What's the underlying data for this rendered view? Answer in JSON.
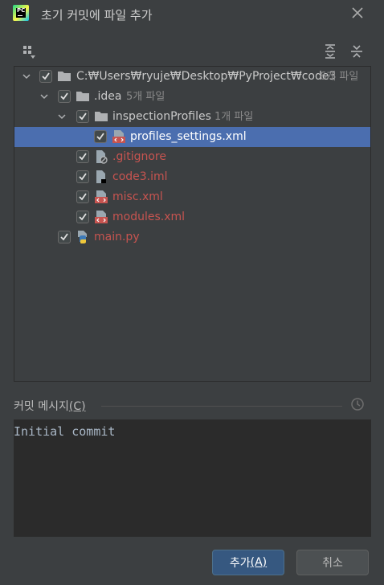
{
  "window": {
    "title": "초기 커밋에 파일 추가",
    "logo_text": "PC"
  },
  "tree": {
    "rows": [
      {
        "label": "C:₩Users₩ryuje₩Desktop₩PyProject₩code3",
        "count": "6개 파일",
        "icon": "folder-icon",
        "expanded": true,
        "checked": true
      },
      {
        "label": ".idea",
        "count": "5개 파일",
        "icon": "folder-icon",
        "expanded": true,
        "checked": true
      },
      {
        "label": "inspectionProfiles",
        "count": "1개 파일",
        "icon": "folder-icon",
        "expanded": true,
        "checked": true
      },
      {
        "label": "profiles_settings.xml",
        "icon": "xml-file-icon",
        "checked": true,
        "selected": true
      },
      {
        "label": ".gitignore",
        "icon": "ignore-file-icon",
        "checked": true
      },
      {
        "label": "code3.iml",
        "icon": "iml-file-icon",
        "checked": true
      },
      {
        "label": "misc.xml",
        "icon": "xml-file-icon",
        "checked": true
      },
      {
        "label": "modules.xml",
        "icon": "xml-file-icon",
        "checked": true
      },
      {
        "label": "main.py",
        "icon": "python-file-icon",
        "checked": true
      }
    ]
  },
  "commit": {
    "label": "커밋 메시지",
    "mnemonic": "(C)",
    "message": "Initial commit"
  },
  "buttons": {
    "add": "추가",
    "add_mnemonic": "(A)",
    "cancel": "취소"
  },
  "colors": {
    "background": "#3c3f41",
    "selection": "#4b6eaf",
    "unversioned": "#c75450",
    "primary_button": "#365880"
  }
}
